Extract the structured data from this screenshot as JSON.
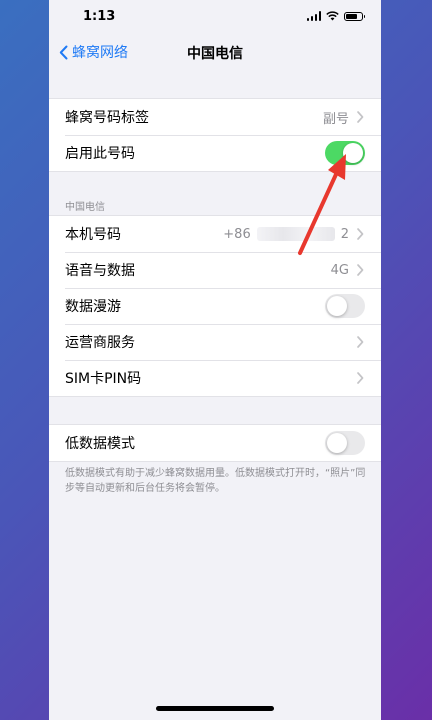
{
  "status_bar": {
    "time": "1:13",
    "battery_level": 0.75
  },
  "nav": {
    "back_label": "蜂窝网络",
    "title": "中国电信"
  },
  "group1": {
    "label_row": {
      "label": "蜂窝号码标签",
      "value": "副号"
    },
    "enable_row": {
      "label": "启用此号码",
      "toggle": true
    }
  },
  "section": {
    "header": "中国电信"
  },
  "group2": {
    "my_number": {
      "label": "本机号码",
      "value_prefix": "+86",
      "value_suffix": "2"
    },
    "voice_data": {
      "label": "语音与数据",
      "value": "4G"
    },
    "data_roaming": {
      "label": "数据漫游",
      "toggle": false
    },
    "carrier_services": {
      "label": "运营商服务"
    },
    "sim_pin": {
      "label": "SIM卡PIN码"
    }
  },
  "group3": {
    "low_data": {
      "label": "低数据模式",
      "toggle": false
    }
  },
  "footer_text": "低数据模式有助于减少蜂窝数据用量。低数据模式打开时，“照片”同步等自动更新和后台任务将会暂停。",
  "colors": {
    "accent": "#1f7af5",
    "toggle_on": "#4cd964",
    "annotation_arrow": "#e8382e"
  }
}
